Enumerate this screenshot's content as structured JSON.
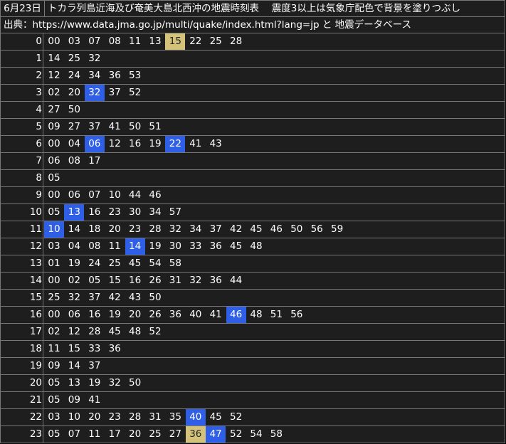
{
  "header": {
    "date": "6月23日",
    "title": "トカラ列島近海及び奄美大島北西沖の地震時刻表　 震度3以上は気象庁配色で背景を塗りつぶし",
    "source": "出典：https://www.data.jma.go.jp/multi/quake/index.html?lang=jp と 地震データベース"
  },
  "colors": {
    "background": "#1e1e1e",
    "grid": "#777777",
    "intensity3": "#2f5fe6",
    "intensity4": "#d4c27a"
  },
  "rows": [
    {
      "hour": "0",
      "minutes": [
        "00",
        "03",
        "07",
        "08",
        "11",
        "13",
        "15",
        "22",
        "25",
        "28"
      ],
      "i3": [],
      "i4": [
        6
      ]
    },
    {
      "hour": "1",
      "minutes": [
        "14",
        "25",
        "32"
      ],
      "i3": [],
      "i4": []
    },
    {
      "hour": "2",
      "minutes": [
        "12",
        "24",
        "34",
        "36",
        "53"
      ],
      "i3": [],
      "i4": []
    },
    {
      "hour": "3",
      "minutes": [
        "02",
        "20",
        "32",
        "37",
        "52"
      ],
      "i3": [
        2
      ],
      "i4": []
    },
    {
      "hour": "4",
      "minutes": [
        "27",
        "50"
      ],
      "i3": [],
      "i4": []
    },
    {
      "hour": "5",
      "minutes": [
        "09",
        "27",
        "37",
        "41",
        "50",
        "51"
      ],
      "i3": [],
      "i4": []
    },
    {
      "hour": "6",
      "minutes": [
        "00",
        "04",
        "06",
        "12",
        "16",
        "19",
        "22",
        "41",
        "43"
      ],
      "i3": [
        2,
        6
      ],
      "i4": []
    },
    {
      "hour": "7",
      "minutes": [
        "06",
        "08",
        "17"
      ],
      "i3": [],
      "i4": []
    },
    {
      "hour": "8",
      "minutes": [
        "05"
      ],
      "i3": [],
      "i4": []
    },
    {
      "hour": "9",
      "minutes": [
        "00",
        "06",
        "07",
        "10",
        "44",
        "46"
      ],
      "i3": [],
      "i4": []
    },
    {
      "hour": "10",
      "minutes": [
        "05",
        "13",
        "16",
        "23",
        "30",
        "34",
        "57"
      ],
      "i3": [
        1
      ],
      "i4": []
    },
    {
      "hour": "11",
      "minutes": [
        "10",
        "14",
        "18",
        "20",
        "23",
        "28",
        "32",
        "34",
        "37",
        "42",
        "45",
        "46",
        "50",
        "56",
        "59"
      ],
      "i3": [
        0
      ],
      "i4": []
    },
    {
      "hour": "12",
      "minutes": [
        "03",
        "04",
        "08",
        "11",
        "14",
        "19",
        "30",
        "33",
        "36",
        "45",
        "48"
      ],
      "i3": [
        4
      ],
      "i4": []
    },
    {
      "hour": "13",
      "minutes": [
        "01",
        "19",
        "24",
        "25",
        "45",
        "54",
        "58"
      ],
      "i3": [],
      "i4": []
    },
    {
      "hour": "14",
      "minutes": [
        "00",
        "02",
        "05",
        "15",
        "16",
        "26",
        "31",
        "32",
        "36",
        "44"
      ],
      "i3": [],
      "i4": []
    },
    {
      "hour": "15",
      "minutes": [
        "25",
        "32",
        "37",
        "42",
        "43",
        "50"
      ],
      "i3": [],
      "i4": []
    },
    {
      "hour": "16",
      "minutes": [
        "00",
        "06",
        "16",
        "19",
        "20",
        "26",
        "36",
        "40",
        "41",
        "46",
        "48",
        "51",
        "56"
      ],
      "i3": [
        9
      ],
      "i4": []
    },
    {
      "hour": "17",
      "minutes": [
        "02",
        "12",
        "28",
        "45",
        "48",
        "52"
      ],
      "i3": [],
      "i4": []
    },
    {
      "hour": "18",
      "minutes": [
        "11",
        "15",
        "33",
        "36"
      ],
      "i3": [],
      "i4": []
    },
    {
      "hour": "19",
      "minutes": [
        "09",
        "14",
        "37"
      ],
      "i3": [],
      "i4": []
    },
    {
      "hour": "20",
      "minutes": [
        "05",
        "13",
        "19",
        "32",
        "50"
      ],
      "i3": [],
      "i4": []
    },
    {
      "hour": "21",
      "minutes": [
        "05",
        "09",
        "41"
      ],
      "i3": [],
      "i4": []
    },
    {
      "hour": "22",
      "minutes": [
        "03",
        "10",
        "20",
        "23",
        "28",
        "31",
        "35",
        "40",
        "45",
        "52"
      ],
      "i3": [
        7
      ],
      "i4": []
    },
    {
      "hour": "23",
      "minutes": [
        "05",
        "07",
        "11",
        "17",
        "20",
        "25",
        "27",
        "36",
        "47",
        "52",
        "54",
        "58"
      ],
      "i3": [
        8
      ],
      "i4": [
        7
      ]
    }
  ]
}
